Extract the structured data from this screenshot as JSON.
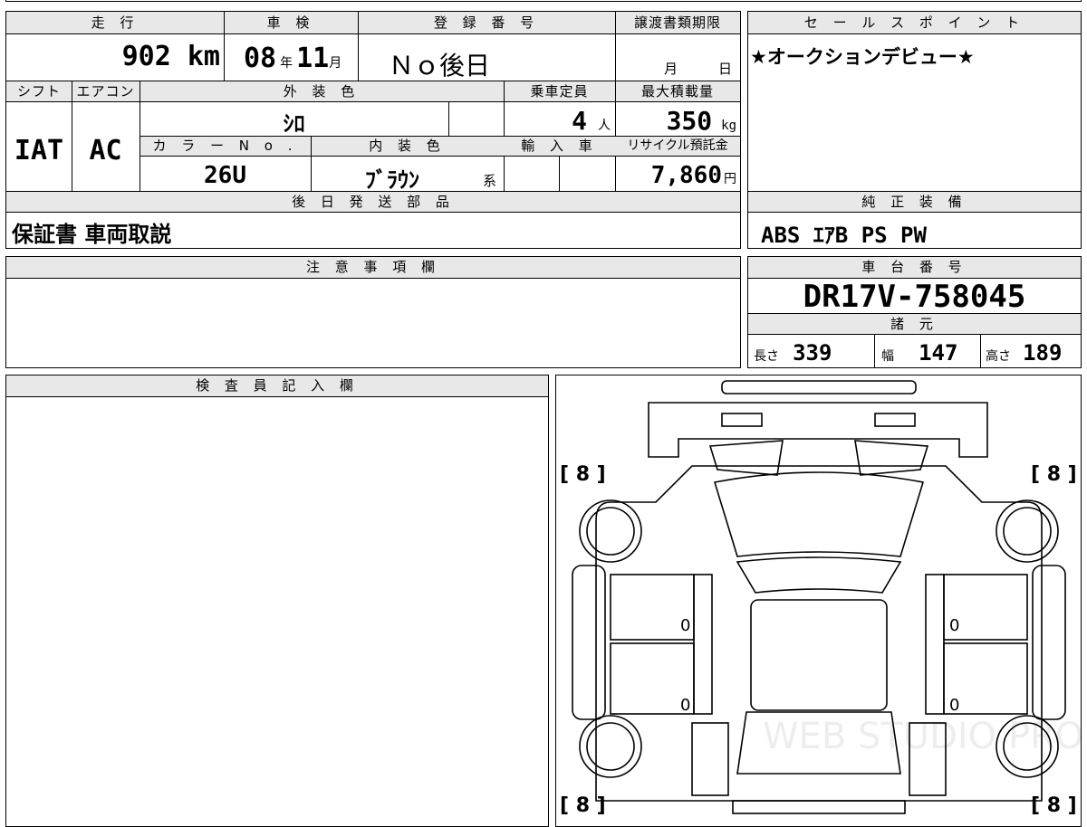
{
  "top": {
    "labels": {
      "mileage": "走 行",
      "inspection": "車 検",
      "registration": "登 録 番 号",
      "transfer_deadline": "譲渡書類期限",
      "sales_point": "セ ー ル ス ポ イ ン ト",
      "shift": "シフト",
      "aircon": "エアコン",
      "exterior_color": "外 装 色",
      "capacity": "乗車定員",
      "max_load": "最大積載量",
      "color_no": "カ ラ ー N o .",
      "interior_color": "内 装 色",
      "import": "輸 入 車",
      "recycle_fee": "リサイクル預託金",
      "later_parts": "後 日 発 送 部 品",
      "genuine_equipment": "純 正 装 備"
    },
    "mileage": {
      "value": "902",
      "unit": "km"
    },
    "inspection": {
      "year": "08",
      "year_unit": "年",
      "month": "11",
      "month_unit": "月"
    },
    "registration": "Ｎｏ後日",
    "transfer": {
      "month_unit": "月",
      "day_unit": "日"
    },
    "sales_point_text": "★オークションデビュー★",
    "shift": "IAT",
    "aircon": "AC",
    "exterior_color": "ｼﾛ",
    "capacity": {
      "value": "4",
      "unit": "人"
    },
    "max_load": {
      "value": "350",
      "unit": "kg"
    },
    "color_no": "26U",
    "interior_color": {
      "value": "ﾌﾞﾗｳﾝ",
      "suffix": "系"
    },
    "recycle_fee": {
      "value": "7,860",
      "unit": "円"
    },
    "later_parts": "保証書 車両取説",
    "genuine_equipment": "ABS ｴｱB PS PW"
  },
  "notes": {
    "label": "注 意 事 項 欄"
  },
  "chassis": {
    "label": "車 台 番 号",
    "value": "DR17V-758045"
  },
  "specs": {
    "label": "諸 元",
    "length_label": "長さ",
    "length": "339",
    "width_label": "幅",
    "width": "147",
    "height_label": "高さ",
    "height": "189"
  },
  "inspector": {
    "label": "検 査 員 記 入 欄"
  },
  "diagram": {
    "tire_top_left": "[ 8 ]",
    "tire_top_right": "[ 8 ]",
    "tire_bottom_left": "[ 8 ]",
    "tire_bottom_right": "[ 8 ]",
    "door_marks": [
      "0",
      "0",
      "0",
      "0"
    ],
    "watermark": "WEB STUDIO PRO"
  }
}
